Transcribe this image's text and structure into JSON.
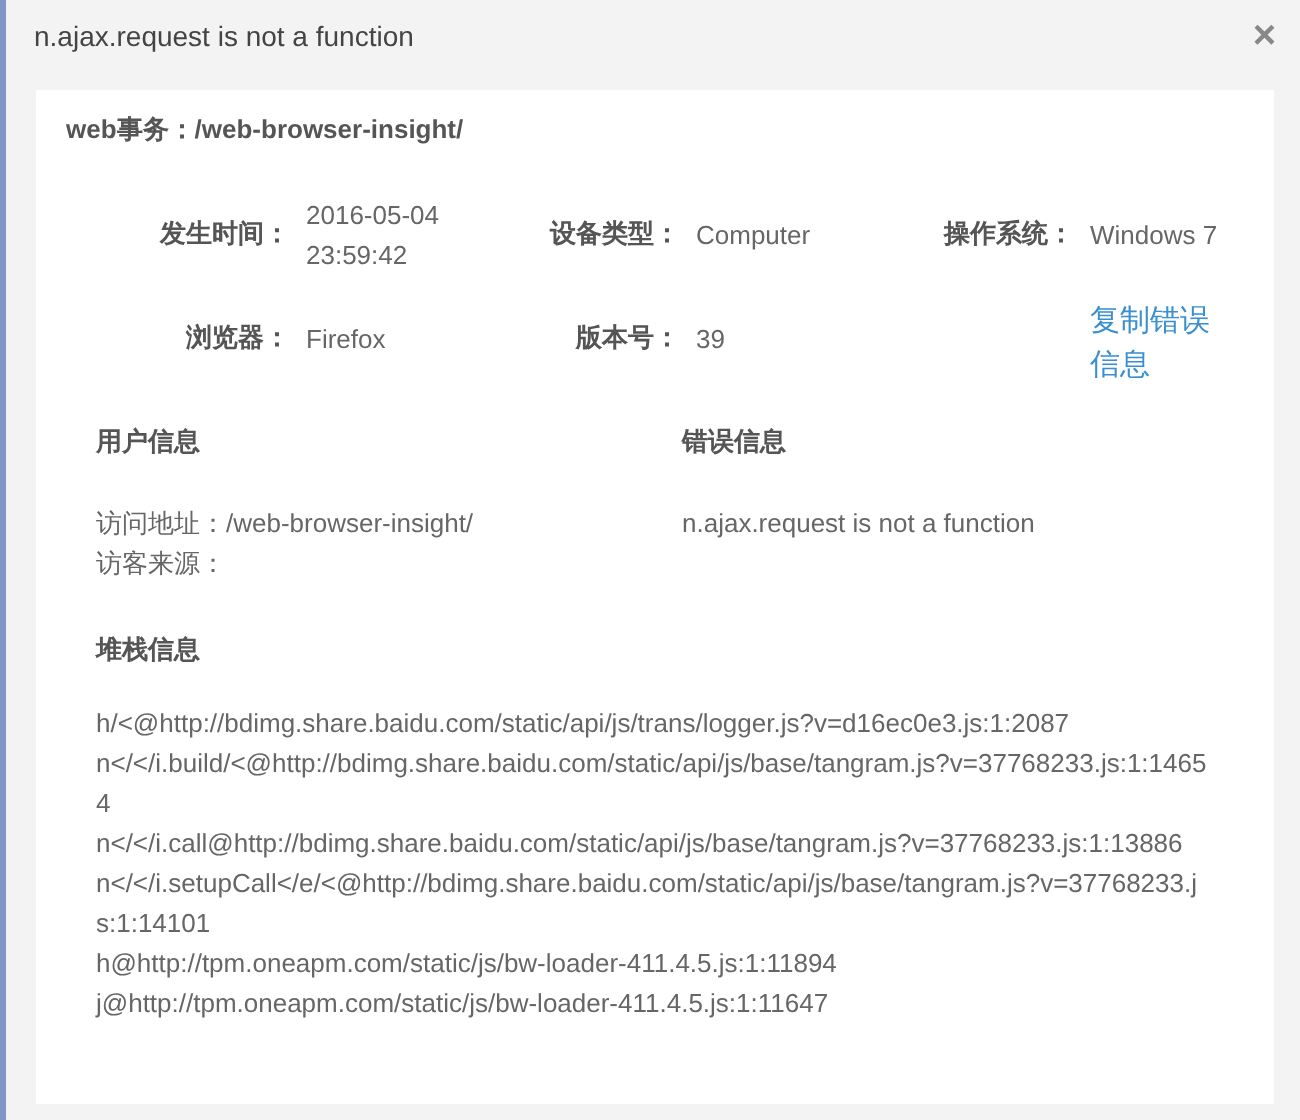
{
  "dialog": {
    "title": "n.ajax.request is not a function",
    "close": "×"
  },
  "transaction": "web事务：/web-browser-insight/",
  "fields": [
    {
      "label": "发生时间：",
      "value": "2016-05-04 23:59:42"
    },
    {
      "label": "设备类型：",
      "value": "Computer"
    },
    {
      "label": "操作系统：",
      "value": "Windows 7"
    },
    {
      "label": "浏览器：",
      "value": "Firefox"
    },
    {
      "label": "版本号：",
      "value": "39"
    }
  ],
  "copy_link": "复制错误信息",
  "user_info": {
    "heading": "用户信息",
    "lines": [
      "访问地址：/web-browser-insight/",
      "访客来源："
    ]
  },
  "error_info": {
    "heading": "错误信息",
    "message": "n.ajax.request is not a function"
  },
  "stack": {
    "heading": "堆栈信息",
    "lines": [
      "h/<@http://bdimg.share.baidu.com/static/api/js/trans/logger.js?v=d16ec0e3.js:1:2087",
      "n</</i.build/<@http://bdimg.share.baidu.com/static/api/js/base/tangram.js?v=37768233.js:1:14654",
      "n</</i.call@http://bdimg.share.baidu.com/static/api/js/base/tangram.js?v=37768233.js:1:13886",
      "n</</i.setupCall</e/<@http://bdimg.share.baidu.com/static/api/js/base/tangram.js?v=37768233.js:1:14101",
      "h@http://tpm.oneapm.com/static/js/bw-loader-411.4.5.js:1:11894",
      "j@http://tpm.oneapm.com/static/js/bw-loader-411.4.5.js:1:11647"
    ]
  }
}
